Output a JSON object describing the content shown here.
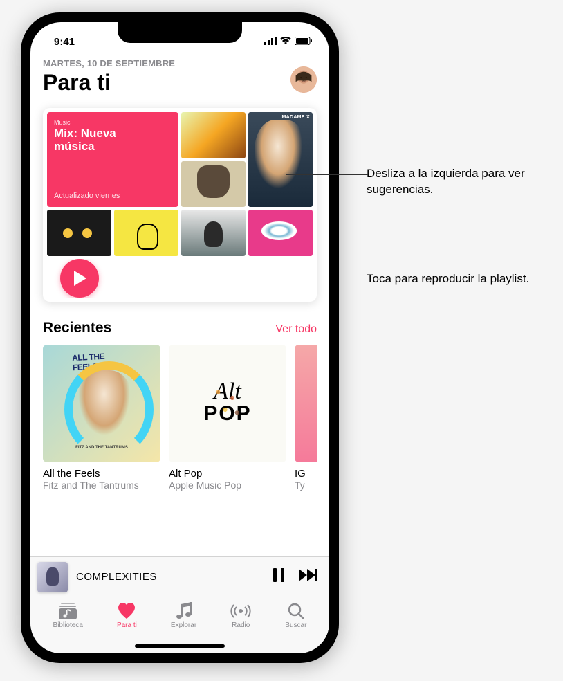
{
  "status": {
    "time": "9:41"
  },
  "header": {
    "date": "MARTES, 10 DE SEPTIEMBRE",
    "title": "Para ti"
  },
  "mix": {
    "brand": "Music",
    "title_line1": "Mix: Nueva",
    "title_line2": "música",
    "subtitle": "Actualizado viernes",
    "madame_label": "MADAME X"
  },
  "recent": {
    "section_title": "Recientes",
    "see_all": "Ver todo",
    "items": [
      {
        "title": "All the Feels",
        "artist": "Fitz and The Tantrums",
        "badge": "ALL THE FEELS",
        "sub_badge": "FITZ AND THE TANTRUMS"
      },
      {
        "title": "Alt Pop",
        "artist": "Apple Music Pop",
        "alt": "Alt",
        "pop": "POP"
      },
      {
        "title": "IG",
        "artist": "Ty"
      }
    ]
  },
  "now_playing": {
    "title": "COMPLEXITIES"
  },
  "tabs": [
    {
      "label": "Biblioteca"
    },
    {
      "label": "Para ti"
    },
    {
      "label": "Explorar"
    },
    {
      "label": "Radio"
    },
    {
      "label": "Buscar"
    }
  ],
  "callouts": {
    "swipe": "Desliza a la izquierda para ver sugerencias.",
    "tap": "Toca para reproducir la playlist."
  },
  "colors": {
    "accent": "#f73765"
  }
}
